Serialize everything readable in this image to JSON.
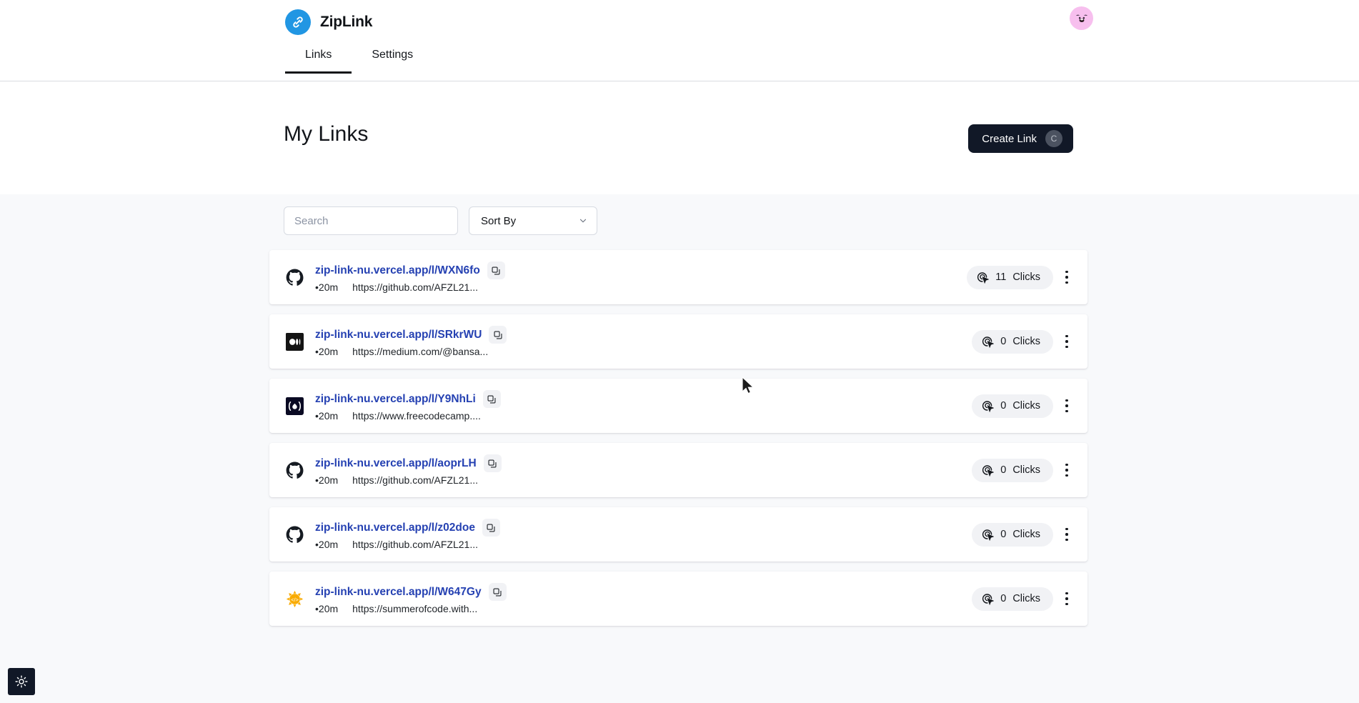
{
  "header": {
    "brand_name": "ZipLink",
    "logo_icon": "link-chain-icon",
    "brand_color": "#2196e3",
    "avatar_icon": "user-avatar-dog-face",
    "avatar_color": "#f7bfee",
    "tabs": [
      {
        "label": "Links",
        "active": true
      },
      {
        "label": "Settings",
        "active": false
      }
    ]
  },
  "hero": {
    "title": "My Links",
    "create_button": {
      "label": "Create Link",
      "shortcut": "C",
      "color": "#111827"
    }
  },
  "controls": {
    "search": {
      "value": "",
      "placeholder": "Search"
    },
    "sort": {
      "label": "Sort By",
      "chevron_icon": "chevron-down-icon"
    }
  },
  "links": [
    {
      "favicon": "github-icon",
      "short_url": "zip-link-nu.vercel.app/l/WXN6fo",
      "copy_icon": "copy-icon",
      "age": "•20m",
      "destination": "https://github.com/AFZL21...",
      "clicks": "11",
      "clicks_label": "Clicks",
      "clicks_icon": "click-cursor-icon",
      "menu_icon": "kebab-menu-icon"
    },
    {
      "favicon": "medium-icon",
      "short_url": "zip-link-nu.vercel.app/l/SRkrWU",
      "copy_icon": "copy-icon",
      "age": "•20m",
      "destination": "https://medium.com/@bansa...",
      "clicks": "0",
      "clicks_label": "Clicks",
      "clicks_icon": "click-cursor-icon",
      "menu_icon": "kebab-menu-icon"
    },
    {
      "favicon": "freecodecamp-icon",
      "short_url": "zip-link-nu.vercel.app/l/Y9NhLi",
      "copy_icon": "copy-icon",
      "age": "•20m",
      "destination": "https://www.freecodecamp....",
      "clicks": "0",
      "clicks_label": "Clicks",
      "clicks_icon": "click-cursor-icon",
      "menu_icon": "kebab-menu-icon"
    },
    {
      "favicon": "github-icon",
      "short_url": "zip-link-nu.vercel.app/l/aoprLH",
      "copy_icon": "copy-icon",
      "age": "•20m",
      "destination": "https://github.com/AFZL21...",
      "clicks": "0",
      "clicks_label": "Clicks",
      "clicks_icon": "click-cursor-icon",
      "menu_icon": "kebab-menu-icon"
    },
    {
      "favicon": "github-icon",
      "short_url": "zip-link-nu.vercel.app/l/z02doe",
      "copy_icon": "copy-icon",
      "age": "•20m",
      "destination": "https://github.com/AFZL21...",
      "clicks": "0",
      "clicks_label": "Clicks",
      "clicks_icon": "click-cursor-icon",
      "menu_icon": "kebab-menu-icon"
    },
    {
      "favicon": "summer-of-code-icon",
      "short_url": "zip-link-nu.vercel.app/l/W647Gy",
      "copy_icon": "copy-icon",
      "age": "•20m",
      "destination": "https://summerofcode.with...",
      "clicks": "0",
      "clicks_label": "Clicks",
      "clicks_icon": "click-cursor-icon",
      "menu_icon": "kebab-menu-icon"
    }
  ],
  "theme_toggle": {
    "icon": "sun-icon",
    "color": "#111827"
  }
}
